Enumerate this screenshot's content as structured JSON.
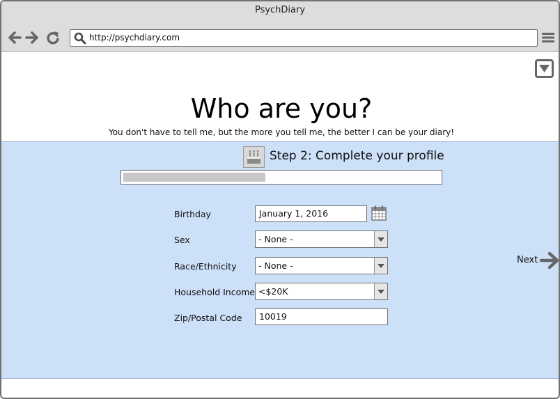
{
  "window": {
    "title": "PsychDiary"
  },
  "toolbar": {
    "url": "http://psychdiary.com"
  },
  "page": {
    "heading": "Who are you?",
    "subheading": "You don't have to tell me, but the more you tell me, the better I can be your diary!"
  },
  "step": {
    "title": "Step 2: Complete your profile",
    "progress_fraction": 0.45
  },
  "form": {
    "birthday": {
      "label": "Birthday",
      "value": "January 1, 2016"
    },
    "sex": {
      "label": "Sex",
      "value": "- None -"
    },
    "race": {
      "label": "Race/Ethnicity",
      "value": "- None -"
    },
    "income": {
      "label": "Household Income",
      "value": "<$20K"
    },
    "zip": {
      "label": "Zip/Postal Code",
      "value": "10019"
    }
  },
  "next": {
    "label": "Next"
  },
  "icons": [
    "back-icon",
    "forward-icon",
    "reload-icon",
    "search-icon",
    "hamburger-menu-icon",
    "dropdown-toggle-icon",
    "cake-icon",
    "calendar-icon",
    "arrow-right-icon"
  ],
  "colors": {
    "panel": "#cce0f8",
    "chrome": "#dddddd",
    "icon": "#666666"
  }
}
